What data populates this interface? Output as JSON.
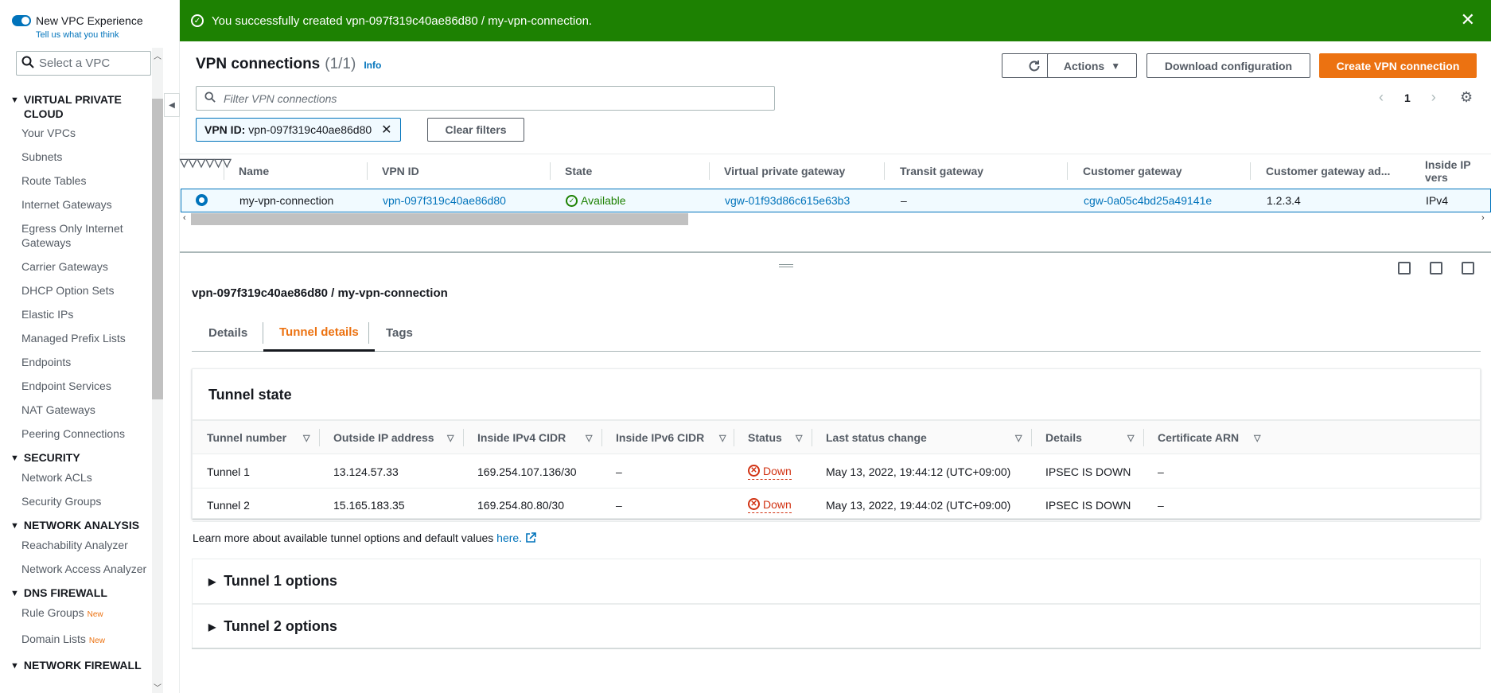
{
  "sidebar": {
    "new_vpc_label": "New VPC Experience",
    "tell_us": "Tell us what you think",
    "vpc_select_placeholder": "Select a VPC",
    "sections": [
      {
        "title": "VIRTUAL PRIVATE CLOUD",
        "items": [
          "Your VPCs",
          "Subnets",
          "Route Tables",
          "Internet Gateways",
          "Egress Only Internet Gateways",
          "Carrier Gateways",
          "DHCP Option Sets",
          "Elastic IPs",
          "Managed Prefix Lists",
          "Endpoints",
          "Endpoint Services",
          "NAT Gateways",
          "Peering Connections"
        ]
      },
      {
        "title": "SECURITY",
        "items": [
          "Network ACLs",
          "Security Groups"
        ]
      },
      {
        "title": "NETWORK ANALYSIS",
        "items": [
          "Reachability Analyzer",
          "Network Access Analyzer"
        ]
      },
      {
        "title": "DNS FIREWALL",
        "items": [
          "Rule Groups",
          "Domain Lists"
        ]
      },
      {
        "title": "NETWORK FIREWALL",
        "items": []
      }
    ],
    "new_badge": "New"
  },
  "flash": {
    "message": "You successfully created vpn-097f319c40ae86d80 / my-vpn-connection."
  },
  "header": {
    "title": "VPN connections",
    "count": "(1/1)",
    "info": "Info"
  },
  "toolbar": {
    "actions": "Actions",
    "download": "Download configuration",
    "create": "Create VPN connection"
  },
  "filter": {
    "placeholder": "Filter VPN connections"
  },
  "pager": {
    "page": "1"
  },
  "token": {
    "key": "VPN ID:",
    "value": "vpn-097f319c40ae86d80",
    "clear": "Clear filters"
  },
  "table": {
    "columns": [
      "Name",
      "VPN ID",
      "State",
      "Virtual private gateway",
      "Transit gateway",
      "Customer gateway",
      "Customer gateway ad...",
      "Inside IP vers"
    ],
    "row": {
      "name": "my-vpn-connection",
      "vpn_id": "vpn-097f319c40ae86d80",
      "state": "Available",
      "vgw": "vgw-01f93d86c615e63b3",
      "tgw": "–",
      "cgw": "cgw-0a05c4bd25a49141e",
      "cgw_addr": "1.2.3.4",
      "ip_ver": "IPv4"
    }
  },
  "details": {
    "title": "vpn-097f319c40ae86d80 / my-vpn-connection",
    "tabs": [
      "Details",
      "Tunnel details",
      "Tags"
    ],
    "active_tab": "Tunnel details",
    "tunnel_state_title": "Tunnel state",
    "tunnel_columns": [
      "Tunnel number",
      "Outside IP address",
      "Inside IPv4 CIDR",
      "Inside IPv6 CIDR",
      "Status",
      "Last status change",
      "Details",
      "Certificate ARN"
    ],
    "tunnels": [
      [
        "Tunnel 1",
        "13.124.57.33",
        "169.254.107.136/30",
        "–",
        "Down",
        "May 13, 2022, 19:44:12 (UTC+09:00)",
        "IPSEC IS DOWN",
        "–"
      ],
      [
        "Tunnel 2",
        "15.165.183.35",
        "169.254.80.80/30",
        "–",
        "Down",
        "May 13, 2022, 19:44:02 (UTC+09:00)",
        "IPSEC IS DOWN",
        "–"
      ]
    ],
    "learn_text": "Learn more about available tunnel options and default values",
    "learn_link": "here.",
    "options": [
      "Tunnel 1 options",
      "Tunnel 2 options"
    ]
  },
  "colors": {
    "success": "#1d8102",
    "primary": "#ec7211",
    "link": "#0073bb",
    "error": "#d13212"
  }
}
